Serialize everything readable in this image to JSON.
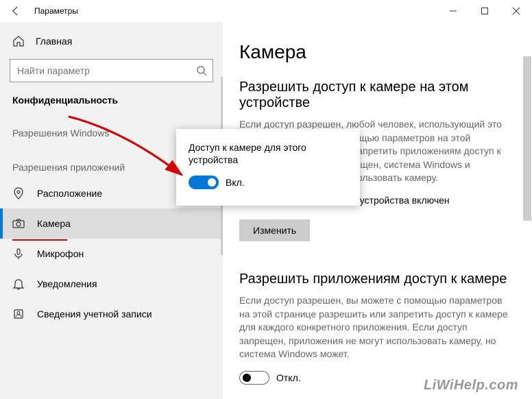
{
  "titlebar": {
    "title": "Параметры"
  },
  "sidebar": {
    "home": "Главная",
    "search_placeholder": "Найти параметр",
    "category": "Конфиденциальность",
    "group1": "Разрешения Windows",
    "group2": "Разрешения приложений",
    "items": [
      {
        "label": "Расположение"
      },
      {
        "label": "Камера"
      },
      {
        "label": "Микрофон"
      },
      {
        "label": "Уведомления"
      },
      {
        "label": "Сведения учетной записи"
      }
    ]
  },
  "main": {
    "page_title": "Камера",
    "section1_title": "Разрешить доступ к камере на этом устройстве",
    "section1_body": "Если доступ разрешен, любой человек, использующий это устройство, сможет с помощью параметров на этой странице разрешить или запретить приложениям доступ к камере. Если доступ запрещен, система Windows и приложения не смогут использовать камеру.",
    "access_status": "Доступ к камере для этого устройства включен",
    "change_button": "Изменить",
    "section2_title": "Разрешить приложениям доступ к камере",
    "section2_body": "Если доступ разрешен, вы можете с помощью параметров на этой странице разрешить или запретить доступ к камере для каждого конкретного приложения. Если доступ запрещен, приложения не могут использовать камеру, но система Windows может.",
    "toggle_off_label": "Откл."
  },
  "popup": {
    "title": "Доступ к камере для этого устройства",
    "toggle_label": "Вкл."
  },
  "watermark": "LiWiHelp.com"
}
